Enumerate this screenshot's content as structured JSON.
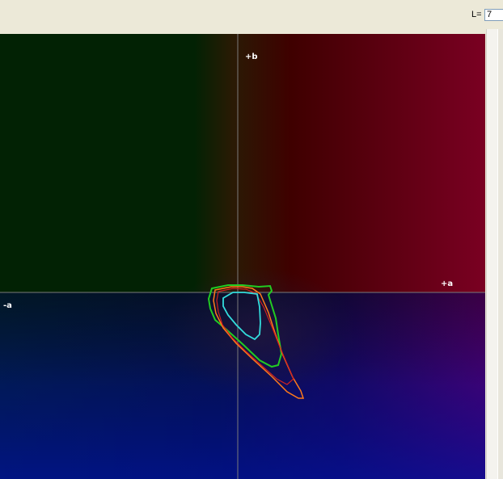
{
  "toolbar": {
    "l_label": "L=",
    "l_value": "7"
  },
  "plot": {
    "axis_labels": {
      "plus_b": "+b",
      "plus_a": "+a",
      "minus_a": "-a"
    },
    "colors": {
      "dark_green": "#022204",
      "dark_red": "#3f0000",
      "crimson": "#6e0020",
      "navy": "#040a6a",
      "purple": "#5a0060",
      "axis_line": "#7a7a7a",
      "gamut_green": "#22cc22",
      "gamut_orange": "#ff7a1a",
      "gamut_red": "#d02020",
      "gamut_cyan": "#33dddd"
    },
    "gamut_outlines": [
      "green",
      "orange",
      "red",
      "cyan"
    ]
  }
}
